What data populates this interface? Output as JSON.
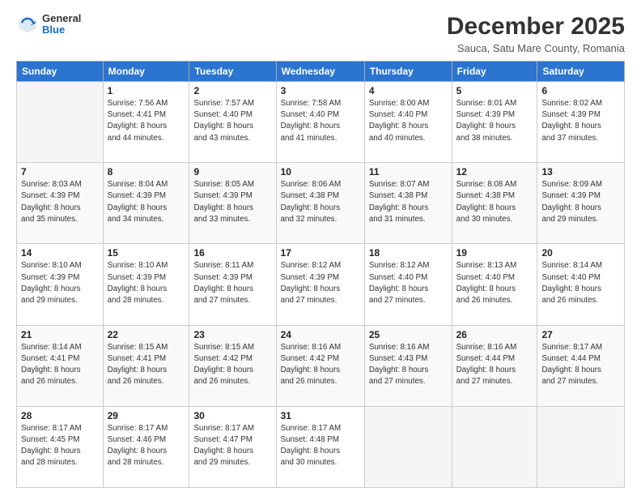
{
  "header": {
    "logo_general": "General",
    "logo_blue": "Blue",
    "month_title": "December 2025",
    "subtitle": "Sauca, Satu Mare County, Romania"
  },
  "weekdays": [
    "Sunday",
    "Monday",
    "Tuesday",
    "Wednesday",
    "Thursday",
    "Friday",
    "Saturday"
  ],
  "weeks": [
    [
      {
        "num": "",
        "info": ""
      },
      {
        "num": "1",
        "info": "Sunrise: 7:56 AM\nSunset: 4:41 PM\nDaylight: 8 hours\nand 44 minutes."
      },
      {
        "num": "2",
        "info": "Sunrise: 7:57 AM\nSunset: 4:40 PM\nDaylight: 8 hours\nand 43 minutes."
      },
      {
        "num": "3",
        "info": "Sunrise: 7:58 AM\nSunset: 4:40 PM\nDaylight: 8 hours\nand 41 minutes."
      },
      {
        "num": "4",
        "info": "Sunrise: 8:00 AM\nSunset: 4:40 PM\nDaylight: 8 hours\nand 40 minutes."
      },
      {
        "num": "5",
        "info": "Sunrise: 8:01 AM\nSunset: 4:39 PM\nDaylight: 8 hours\nand 38 minutes."
      },
      {
        "num": "6",
        "info": "Sunrise: 8:02 AM\nSunset: 4:39 PM\nDaylight: 8 hours\nand 37 minutes."
      }
    ],
    [
      {
        "num": "7",
        "info": "Sunrise: 8:03 AM\nSunset: 4:39 PM\nDaylight: 8 hours\nand 35 minutes."
      },
      {
        "num": "8",
        "info": "Sunrise: 8:04 AM\nSunset: 4:39 PM\nDaylight: 8 hours\nand 34 minutes."
      },
      {
        "num": "9",
        "info": "Sunrise: 8:05 AM\nSunset: 4:39 PM\nDaylight: 8 hours\nand 33 minutes."
      },
      {
        "num": "10",
        "info": "Sunrise: 8:06 AM\nSunset: 4:38 PM\nDaylight: 8 hours\nand 32 minutes."
      },
      {
        "num": "11",
        "info": "Sunrise: 8:07 AM\nSunset: 4:38 PM\nDaylight: 8 hours\nand 31 minutes."
      },
      {
        "num": "12",
        "info": "Sunrise: 8:08 AM\nSunset: 4:38 PM\nDaylight: 8 hours\nand 30 minutes."
      },
      {
        "num": "13",
        "info": "Sunrise: 8:09 AM\nSunset: 4:39 PM\nDaylight: 8 hours\nand 29 minutes."
      }
    ],
    [
      {
        "num": "14",
        "info": "Sunrise: 8:10 AM\nSunset: 4:39 PM\nDaylight: 8 hours\nand 29 minutes."
      },
      {
        "num": "15",
        "info": "Sunrise: 8:10 AM\nSunset: 4:39 PM\nDaylight: 8 hours\nand 28 minutes."
      },
      {
        "num": "16",
        "info": "Sunrise: 8:11 AM\nSunset: 4:39 PM\nDaylight: 8 hours\nand 27 minutes."
      },
      {
        "num": "17",
        "info": "Sunrise: 8:12 AM\nSunset: 4:39 PM\nDaylight: 8 hours\nand 27 minutes."
      },
      {
        "num": "18",
        "info": "Sunrise: 8:12 AM\nSunset: 4:40 PM\nDaylight: 8 hours\nand 27 minutes."
      },
      {
        "num": "19",
        "info": "Sunrise: 8:13 AM\nSunset: 4:40 PM\nDaylight: 8 hours\nand 26 minutes."
      },
      {
        "num": "20",
        "info": "Sunrise: 8:14 AM\nSunset: 4:40 PM\nDaylight: 8 hours\nand 26 minutes."
      }
    ],
    [
      {
        "num": "21",
        "info": "Sunrise: 8:14 AM\nSunset: 4:41 PM\nDaylight: 8 hours\nand 26 minutes."
      },
      {
        "num": "22",
        "info": "Sunrise: 8:15 AM\nSunset: 4:41 PM\nDaylight: 8 hours\nand 26 minutes."
      },
      {
        "num": "23",
        "info": "Sunrise: 8:15 AM\nSunset: 4:42 PM\nDaylight: 8 hours\nand 26 minutes."
      },
      {
        "num": "24",
        "info": "Sunrise: 8:16 AM\nSunset: 4:42 PM\nDaylight: 8 hours\nand 26 minutes."
      },
      {
        "num": "25",
        "info": "Sunrise: 8:16 AM\nSunset: 4:43 PM\nDaylight: 8 hours\nand 27 minutes."
      },
      {
        "num": "26",
        "info": "Sunrise: 8:16 AM\nSunset: 4:44 PM\nDaylight: 8 hours\nand 27 minutes."
      },
      {
        "num": "27",
        "info": "Sunrise: 8:17 AM\nSunset: 4:44 PM\nDaylight: 8 hours\nand 27 minutes."
      }
    ],
    [
      {
        "num": "28",
        "info": "Sunrise: 8:17 AM\nSunset: 4:45 PM\nDaylight: 8 hours\nand 28 minutes."
      },
      {
        "num": "29",
        "info": "Sunrise: 8:17 AM\nSunset: 4:46 PM\nDaylight: 8 hours\nand 28 minutes."
      },
      {
        "num": "30",
        "info": "Sunrise: 8:17 AM\nSunset: 4:47 PM\nDaylight: 8 hours\nand 29 minutes."
      },
      {
        "num": "31",
        "info": "Sunrise: 8:17 AM\nSunset: 4:48 PM\nDaylight: 8 hours\nand 30 minutes."
      },
      {
        "num": "",
        "info": ""
      },
      {
        "num": "",
        "info": ""
      },
      {
        "num": "",
        "info": ""
      }
    ]
  ]
}
